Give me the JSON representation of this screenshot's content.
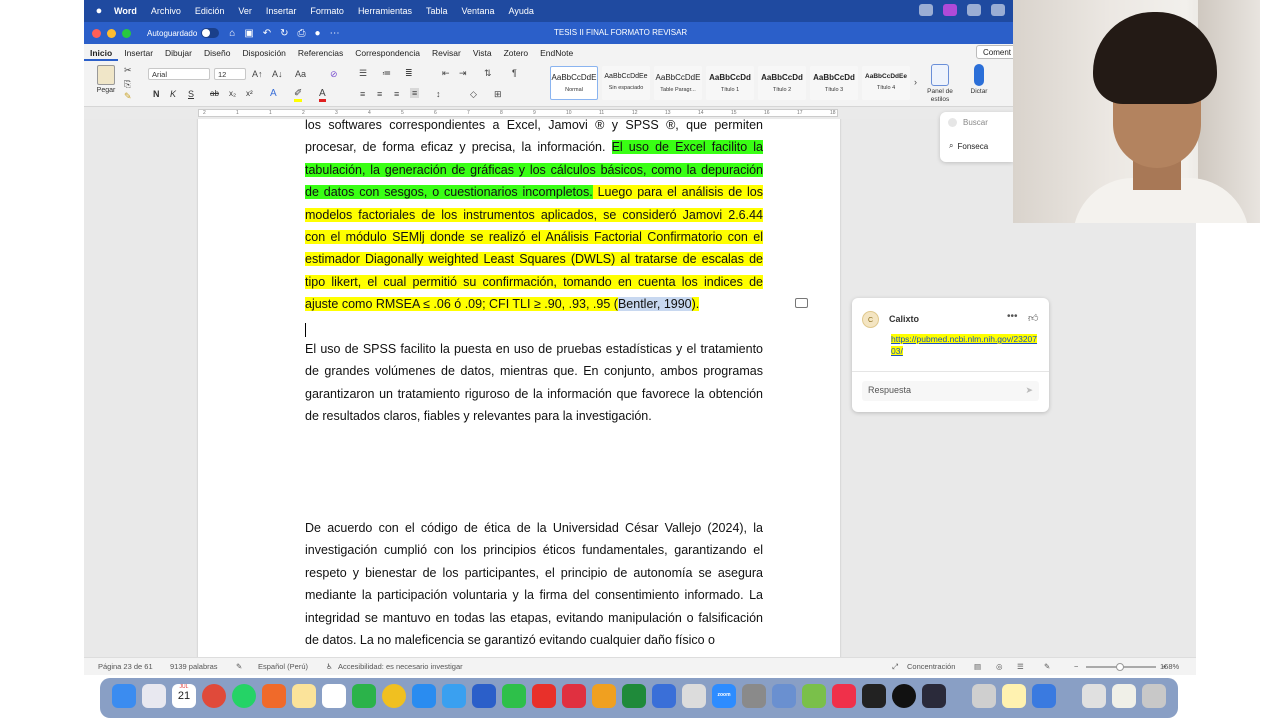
{
  "menubar": {
    "app_name": "Word",
    "items": [
      "Archivo",
      "Edición",
      "Ver",
      "Insertar",
      "Formato",
      "Herramientas",
      "Tabla",
      "Ventana",
      "Ayuda"
    ]
  },
  "titlebar": {
    "autosave_label": "Autoguardado",
    "doc_title": "TESIS II FINAL FORMATO REVISAR"
  },
  "tabs": [
    "Inicio",
    "Insertar",
    "Dibujar",
    "Diseño",
    "Disposición",
    "Referencias",
    "Correspondencia",
    "Revisar",
    "Vista",
    "Zotero",
    "EndNote"
  ],
  "comment_button": "Coment",
  "ribbon": {
    "paste_label": "Pegar",
    "font_name": "Arial",
    "font_size": "12",
    "bold": "N",
    "italic": "K",
    "underline": "S",
    "strike": "ab",
    "subscript": "x₂",
    "superscript": "x²",
    "styles": [
      {
        "sample": "AaBbCcDdE",
        "name": "Normal"
      },
      {
        "sample": "AaBbCcDdEe",
        "name": "Sin espaciado"
      },
      {
        "sample": "AaBbCcDdE",
        "name": "Table Paragr..."
      },
      {
        "sample": "AaBbCcDd",
        "name": "Título 1"
      },
      {
        "sample": "AaBbCcDd",
        "name": "Título 2"
      },
      {
        "sample": "AaBbCcDd",
        "name": "Título 3"
      },
      {
        "sample": "AaBbCcDdEe",
        "name": "Título 4"
      }
    ],
    "styles_pane_label": "Panel de estilos",
    "dictate_label": "Dictar"
  },
  "ruler_numbers": [
    "2",
    "1",
    "1",
    "2",
    "3",
    "4",
    "5",
    "6",
    "7",
    "8",
    "9",
    "10",
    "11",
    "12",
    "13",
    "14",
    "15",
    "16",
    "17",
    "18"
  ],
  "search_panel": {
    "placeholder": "Buscar",
    "result": "Fonseca"
  },
  "document": {
    "p1_normal": "los softwares correspondientes a Excel, Jamovi ® y SPSS ®, que permiten procesar, de forma eficaz y precisa, la información. ",
    "p1_green": "El uso de Excel facilito la tabulación, la generación de gráficas y los cálculos básicos, como la depuración de datos con sesgos, o cuestionarios incompletos.",
    "p1_yellow": " Luego para el análisis de los modelos factoriales de los instrumentos aplicados, se consideró Jamovi 2.6.44 con el módulo SEMlj donde se realizó el Análisis Factorial Confirmatorio con el estimador Diagonally weighted Least Squares (DWLS) al tratarse de escalas de tipo likert, el cual permitió su confirmación, tomando en cuenta los indices de ajuste como RMSEA ≤ .06 ó .09; CFI TLI ≥ .90, .93, .95 (",
    "p1_cite": "Bentler, 1990",
    "p1_end": ").",
    "p2": "El uso de SPSS facilito la puesta en uso de pruebas estadísticas y el tratamiento de grandes volúmenes de datos, mientras que. En conjunto, ambos programas garantizaron un tratamiento riguroso de la información que favorece la obtención de resultados claros, fiables y relevantes para la investigación.",
    "p3": "De acuerdo con el código de ética de la Universidad César Vallejo (2024), la investigación cumplió con los principios éticos fundamentales, garantizando el respeto y bienestar de los participantes, el principio de autonomía se asegura mediante la participación voluntaria y la firma del consentimiento informado. La integridad se mantuvo en todas las etapas, evitando manipulación o falsificación de datos. La no maleficencia se garantizó evitando cualquier daño físico o"
  },
  "comment": {
    "avatar_initial": "C",
    "author": "Calixto",
    "link": "https://pubmed.ncbi.nlm.nih.gov/2320703/",
    "reply_placeholder": "Respuesta"
  },
  "statusbar": {
    "page": "Página 23 de 61",
    "words": "9139 palabras",
    "language": "Español (Perú)",
    "accessibility": "Accesibilidad: es necesario investigar",
    "focus": "Concentración",
    "zoom": "168%"
  },
  "dock": {
    "calendar_day": "21",
    "calendar_month": "JUL",
    "zoom_label": "zoom"
  },
  "colors": {
    "menubar": "#1f4aa0",
    "titlebar": "#2b5fc9",
    "highlight_green": "#39ff14",
    "highlight_yellow": "#ffff00"
  }
}
